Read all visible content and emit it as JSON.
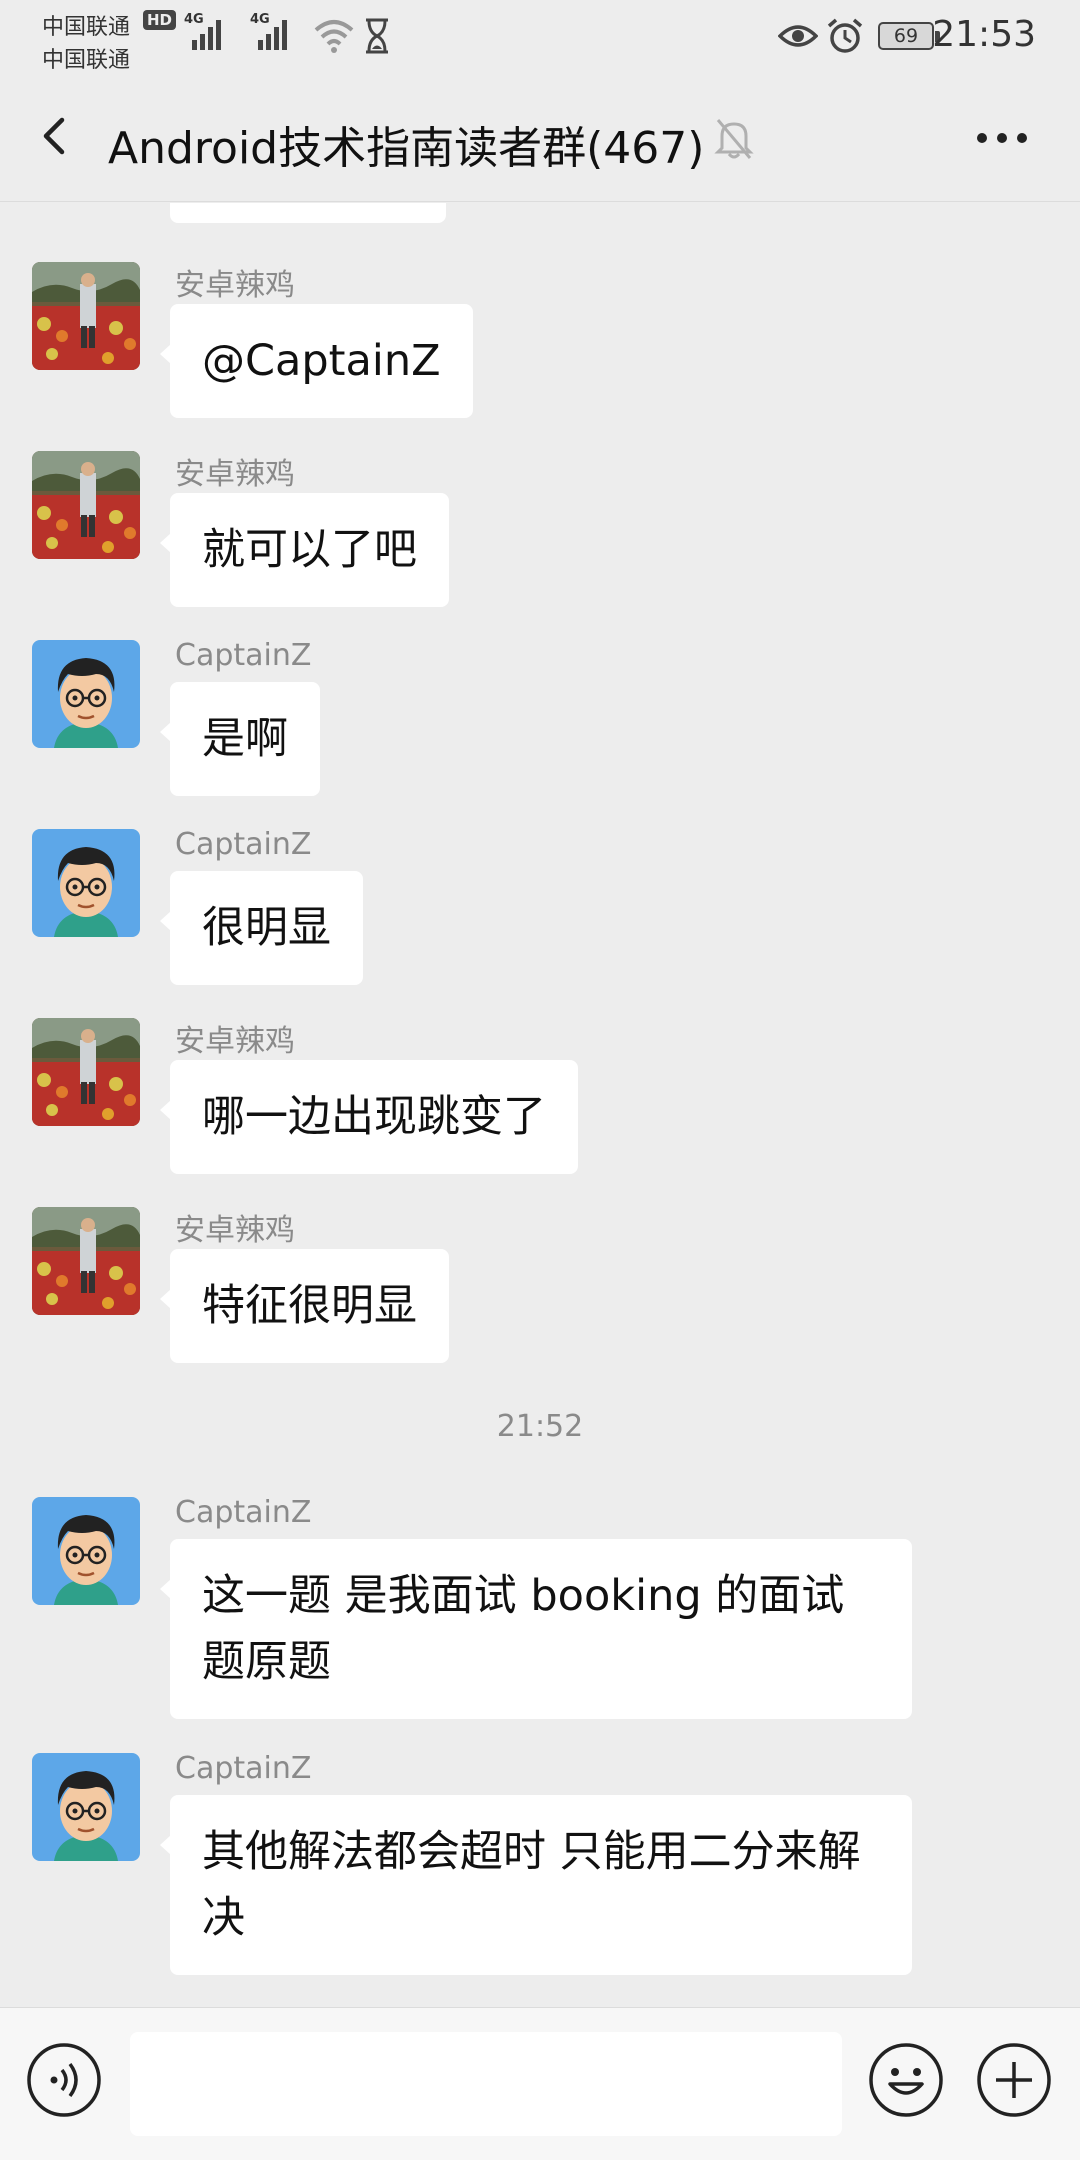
{
  "status_bar": {
    "carrier_1": "中国联通",
    "carrier_2": "中国联通",
    "hd_badge": "HD",
    "network_1": "4G",
    "network_2": "4G",
    "battery": "69",
    "time": "21:53",
    "icons": [
      "signal-icon",
      "wifi-icon",
      "hourglass-icon",
      "eye-icon",
      "alarm-icon",
      "battery-icon"
    ]
  },
  "header": {
    "title": "Android技术指南读者群(467)",
    "icons": [
      "back-icon",
      "mute-icon",
      "more-icon"
    ]
  },
  "messages": [
    {
      "sender": "安卓辣鸡",
      "text": "@CaptainZ",
      "avatar": "photo-avatar"
    },
    {
      "sender": "安卓辣鸡",
      "text": "就可以了吧",
      "avatar": "photo-avatar"
    },
    {
      "sender": "CaptainZ",
      "text": "是啊",
      "avatar": "cartoon-avatar"
    },
    {
      "sender": "CaptainZ",
      "text": "很明显",
      "avatar": "cartoon-avatar"
    },
    {
      "sender": "安卓辣鸡",
      "text": "哪一边出现跳变了",
      "avatar": "photo-avatar"
    },
    {
      "sender": "安卓辣鸡",
      "text": "特征很明显",
      "avatar": "photo-avatar"
    },
    {
      "sender": "CaptainZ",
      "text": "这一题 是我面试 booking 的面试题原题",
      "avatar": "cartoon-avatar"
    },
    {
      "sender": "CaptainZ",
      "text": "其他解法都会超时 只能用二分来解决",
      "avatar": "cartoon-avatar"
    }
  ],
  "timestamp": "21:52",
  "input_bar": {
    "value": "",
    "icons": [
      "voice-icon",
      "emoji-icon",
      "plus-icon"
    ]
  }
}
